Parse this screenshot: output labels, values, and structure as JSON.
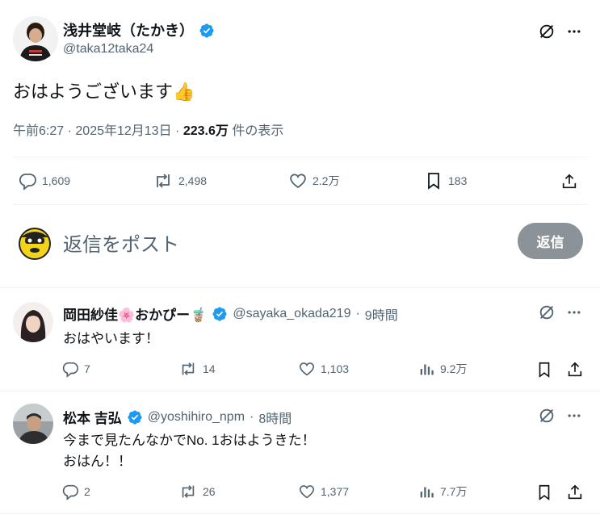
{
  "main_post": {
    "display_name": "浅井堂岐（たかき）",
    "handle": "@taka12taka24",
    "text": "おはようございます👍",
    "time": "午前6:27",
    "date": "2025年12月13日",
    "views_count": "223.6万",
    "views_label": "件の表示",
    "replies": "1,609",
    "reposts": "2,498",
    "likes": "2.2万",
    "bookmarks": "183"
  },
  "compose": {
    "placeholder": "返信をポスト",
    "button_label": "返信"
  },
  "replies": [
    {
      "display_name": "岡田紗佳🌸おかぴー🧋",
      "handle": "@sayaka_okada219",
      "time": "9時間",
      "text_lines": [
        "おはやいます！"
      ],
      "replies": "7",
      "reposts": "14",
      "likes": "1,103",
      "views": "9.2万"
    },
    {
      "display_name": "松本 吉弘",
      "handle": "@yoshihiro_npm",
      "time": "8時間",
      "text_lines": [
        "今まで見たんなかでNo. 1おはようきた！",
        "おはん！！"
      ],
      "replies": "2",
      "reposts": "26",
      "likes": "1,377",
      "views": "7.7万"
    }
  ],
  "colors": {
    "verified": "#1d9bf0",
    "reply_button_bg": "#8b9298",
    "secondary_text": "#536471"
  },
  "icons": [
    "grok-icon",
    "more-icon",
    "reply-icon",
    "repost-icon",
    "like-icon",
    "bookmark-icon",
    "share-icon",
    "views-icon",
    "verified-badge-icon"
  ]
}
